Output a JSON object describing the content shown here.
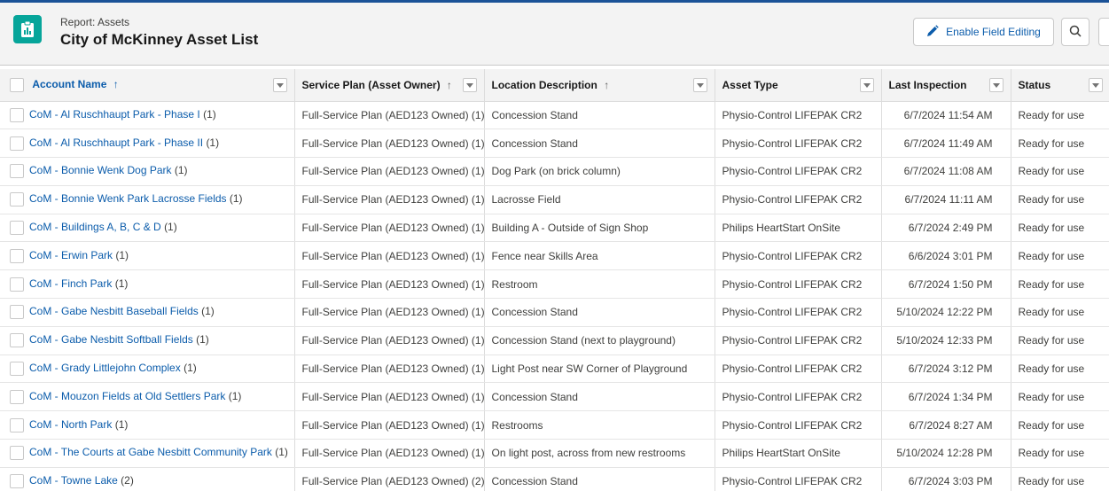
{
  "header": {
    "eyebrow": "Report: Assets",
    "title": "City of McKinney Asset List",
    "enable_edit_label": "Enable Field Editing",
    "icons": {
      "report": "report-icon",
      "edit": "pencil-icon",
      "search": "search-icon"
    }
  },
  "colors": {
    "accent": "#0b5cab",
    "report_icon_bg": "#06a59a",
    "header_bg": "#f3f3f3"
  },
  "table": {
    "columns": [
      {
        "label": "Account Name",
        "sort": "↑"
      },
      {
        "label": "Service Plan (Asset Owner)",
        "sort": "↑"
      },
      {
        "label": "Location Description",
        "sort": "↑"
      },
      {
        "label": "Asset Type",
        "sort": ""
      },
      {
        "label": "Last Inspection",
        "sort": ""
      },
      {
        "label": "Status",
        "sort": ""
      }
    ],
    "rows": [
      {
        "account": "CoM - Al Ruschhaupt Park - Phase I",
        "count": "(1)",
        "plan": "Full-Service Plan (AED123 Owned) (1)",
        "location": "Concession Stand",
        "asset_type": "Physio-Control LIFEPAK CR2",
        "inspection": "6/7/2024 11:54 AM",
        "status": "Ready for use"
      },
      {
        "account": "CoM - Al Ruschhaupt Park - Phase II",
        "count": "(1)",
        "plan": "Full-Service Plan (AED123 Owned) (1)",
        "location": "Concession Stand",
        "asset_type": "Physio-Control LIFEPAK CR2",
        "inspection": "6/7/2024 11:49 AM",
        "status": "Ready for use"
      },
      {
        "account": "CoM - Bonnie Wenk Dog Park",
        "count": "(1)",
        "plan": "Full-Service Plan (AED123 Owned) (1)",
        "location": "Dog Park (on brick column)",
        "asset_type": "Physio-Control LIFEPAK CR2",
        "inspection": "6/7/2024 11:08 AM",
        "status": "Ready for use"
      },
      {
        "account": "CoM - Bonnie Wenk Park Lacrosse Fields",
        "count": "(1)",
        "plan": "Full-Service Plan (AED123 Owned) (1)",
        "location": "Lacrosse Field",
        "asset_type": "Physio-Control LIFEPAK CR2",
        "inspection": "6/7/2024 11:11 AM",
        "status": "Ready for use"
      },
      {
        "account": "CoM - Buildings A, B, C & D",
        "count": "(1)",
        "plan": "Full-Service Plan (AED123 Owned) (1)",
        "location": "Building A - Outside of Sign Shop",
        "asset_type": "Philips HeartStart OnSite",
        "inspection": "6/7/2024 2:49 PM",
        "status": "Ready for use"
      },
      {
        "account": "CoM - Erwin Park",
        "count": "(1)",
        "plan": "Full-Service Plan (AED123 Owned) (1)",
        "location": "Fence near Skills Area",
        "asset_type": "Physio-Control LIFEPAK CR2",
        "inspection": "6/6/2024 3:01 PM",
        "status": "Ready for use"
      },
      {
        "account": "CoM - Finch Park",
        "count": "(1)",
        "plan": "Full-Service Plan (AED123 Owned) (1)",
        "location": "Restroom",
        "asset_type": "Physio-Control LIFEPAK CR2",
        "inspection": "6/7/2024 1:50 PM",
        "status": "Ready for use"
      },
      {
        "account": "CoM - Gabe Nesbitt Baseball Fields",
        "count": "(1)",
        "plan": "Full-Service Plan (AED123 Owned) (1)",
        "location": "Concession Stand",
        "asset_type": "Physio-Control LIFEPAK CR2",
        "inspection": "5/10/2024 12:22 PM",
        "status": "Ready for use"
      },
      {
        "account": "CoM - Gabe Nesbitt Softball Fields",
        "count": "(1)",
        "plan": "Full-Service Plan (AED123 Owned) (1)",
        "location": "Concession Stand (next to playground)",
        "asset_type": "Physio-Control LIFEPAK CR2",
        "inspection": "5/10/2024 12:33 PM",
        "status": "Ready for use"
      },
      {
        "account": "CoM - Grady Littlejohn Complex",
        "count": "(1)",
        "plan": "Full-Service Plan (AED123 Owned) (1)",
        "location": "Light Post near SW Corner of Playground",
        "asset_type": "Physio-Control LIFEPAK CR2",
        "inspection": "6/7/2024 3:12 PM",
        "status": "Ready for use"
      },
      {
        "account": "CoM - Mouzon Fields at Old Settlers Park",
        "count": "(1)",
        "plan": "Full-Service Plan (AED123 Owned) (1)",
        "location": "Concession Stand",
        "asset_type": "Physio-Control LIFEPAK CR2",
        "inspection": "6/7/2024 1:34 PM",
        "status": "Ready for use"
      },
      {
        "account": "CoM - North Park",
        "count": "(1)",
        "plan": "Full-Service Plan (AED123 Owned) (1)",
        "location": "Restrooms",
        "asset_type": "Physio-Control LIFEPAK CR2",
        "inspection": "6/7/2024 8:27 AM",
        "status": "Ready for use"
      },
      {
        "account": "CoM - The Courts at Gabe Nesbitt Community Park",
        "count": "(1)",
        "plan": "Full-Service Plan (AED123 Owned) (1)",
        "location": "On light post, across from new restrooms",
        "asset_type": "Philips HeartStart OnSite",
        "inspection": "5/10/2024 12:28 PM",
        "status": "Ready for use"
      },
      {
        "account": "CoM - Towne Lake",
        "count": "(2)",
        "plan": "Full-Service Plan (AED123 Owned) (2)",
        "location": "Concession Stand",
        "asset_type": "Physio-Control LIFEPAK CR2",
        "inspection": "6/7/2024 3:03 PM",
        "status": "Ready for use"
      }
    ]
  }
}
